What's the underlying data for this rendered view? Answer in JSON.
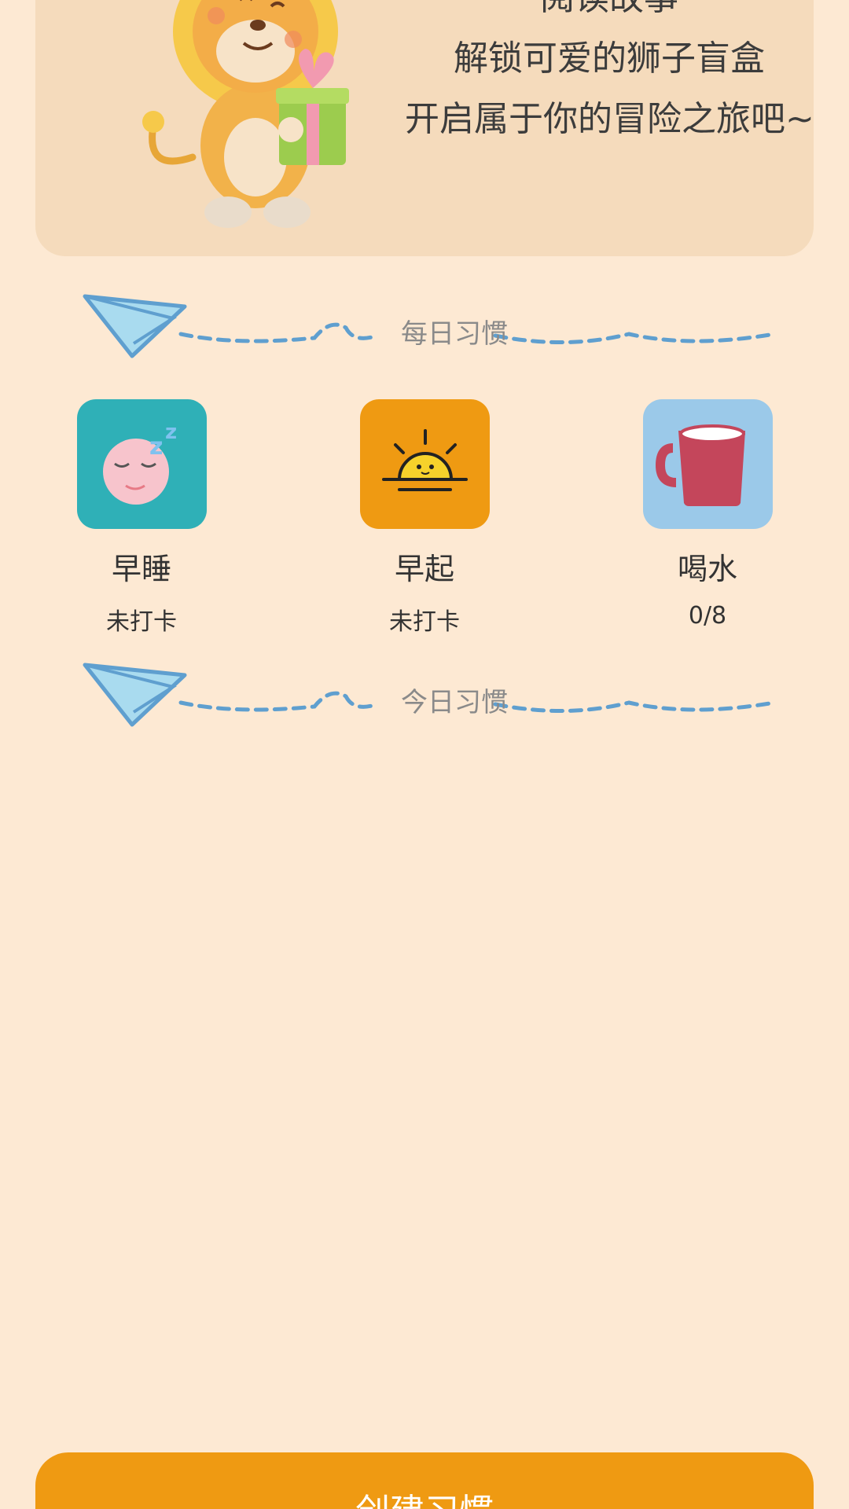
{
  "banner": {
    "lines": [
      "阅读故事",
      "解锁可爱的狮子盲盒",
      "开启属于你的冒险之旅吧~"
    ]
  },
  "sections": {
    "daily": "每日习惯",
    "today": "今日习惯"
  },
  "habits": [
    {
      "name": "早睡",
      "status": "未打卡",
      "icon": "sleeping-face-icon",
      "color": "#2fb0b7"
    },
    {
      "name": "早起",
      "status": "未打卡",
      "icon": "sunrise-icon",
      "color": "#ef9a12"
    },
    {
      "name": "喝水",
      "status": "0/8",
      "icon": "mug-icon",
      "color": "#9bc9e9"
    }
  ],
  "footer": {
    "create_label": "创建习惯"
  },
  "colors": {
    "background": "#fde9d3",
    "banner": "#f5dbbc",
    "accent": "#ef9a12",
    "plane": "#5f9fcf"
  }
}
